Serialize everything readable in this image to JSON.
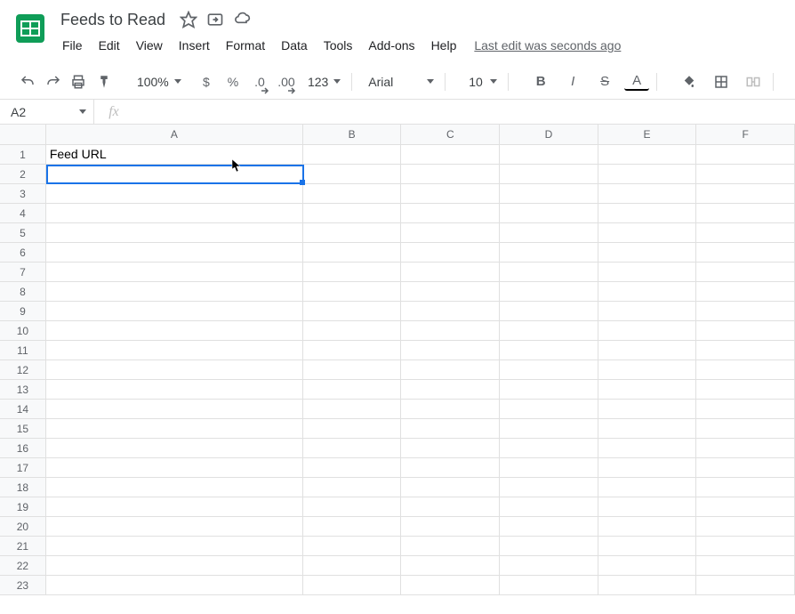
{
  "doc": {
    "title": "Feeds to Read",
    "last_edit": "Last edit was seconds ago"
  },
  "menu": {
    "file": "File",
    "edit": "Edit",
    "view": "View",
    "insert": "Insert",
    "format": "Format",
    "data": "Data",
    "tools": "Tools",
    "addons": "Add-ons",
    "help": "Help"
  },
  "toolbar": {
    "zoom": "100%",
    "currency": "$",
    "percent": "%",
    "dec_minus": ".0",
    "dec_plus": ".00",
    "more_formats": "123",
    "font": "Arial",
    "font_size": "10",
    "bold": "B",
    "italic": "I",
    "strike": "S",
    "text_color": "A"
  },
  "name_box": {
    "value": "A2"
  },
  "fx": {
    "label": "fx",
    "value": ""
  },
  "columns": [
    "A",
    "B",
    "C",
    "D",
    "E",
    "F"
  ],
  "rows": [
    "1",
    "2",
    "3",
    "4",
    "5",
    "6",
    "7",
    "8",
    "9",
    "10",
    "11",
    "12",
    "13",
    "14",
    "15",
    "16",
    "17",
    "18",
    "19",
    "20",
    "21",
    "22",
    "23"
  ],
  "cells": {
    "A1": "Feed URL"
  },
  "selection": {
    "col": "A",
    "row": 2
  }
}
